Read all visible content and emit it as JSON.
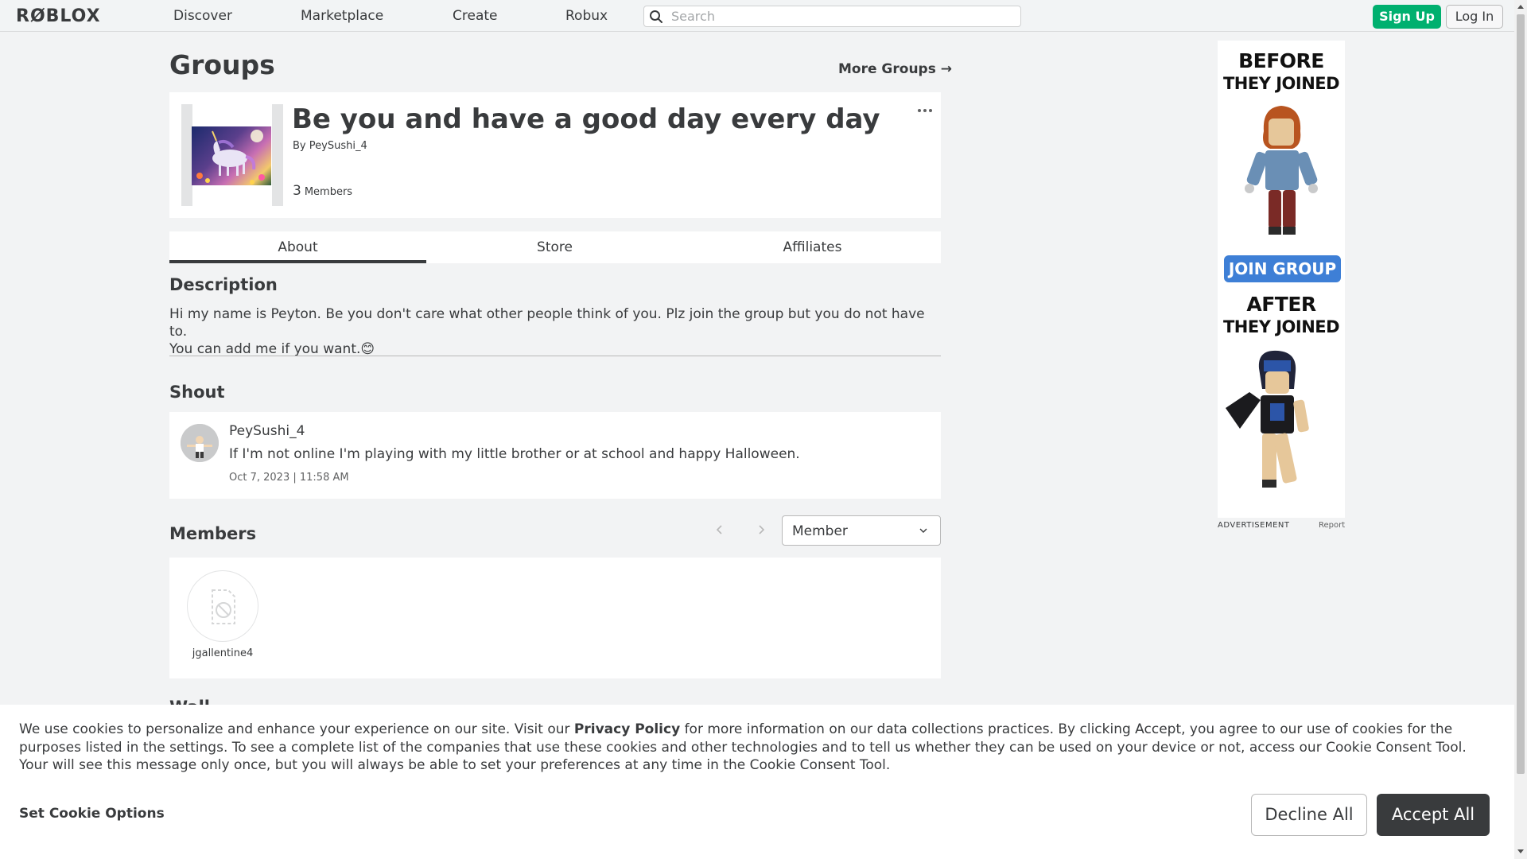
{
  "nav": {
    "logo": "RØBLOX",
    "links": [
      "Discover",
      "Marketplace",
      "Create",
      "Robux"
    ],
    "search_placeholder": "Search",
    "signup": "Sign Up",
    "login": "Log In"
  },
  "page": {
    "title": "Groups",
    "more_groups": "More Groups →"
  },
  "group": {
    "name": "Be you and have a good day every day",
    "by_prefix": "By",
    "owner": "PeySushi_4",
    "member_count": "3",
    "member_label": "Members"
  },
  "tabs": [
    "About",
    "Store",
    "Affiliates"
  ],
  "about": {
    "description_heading": "Description",
    "description_line1": "Hi my name is Peyton. Be you don't care what other people think of you. Plz join the group but you do not have to.",
    "description_line2": "You can add me if you want.😊"
  },
  "shout": {
    "heading": "Shout",
    "user": "PeySushi_4",
    "text": "If I'm not online I'm playing with my little brother or at school and happy Halloween.",
    "date": "Oct 7, 2023 | 11:58 AM"
  },
  "members": {
    "heading": "Members",
    "role_selected": "Member",
    "list": [
      {
        "name": "jgallentine4"
      }
    ]
  },
  "wall": {
    "heading": "Wall"
  },
  "ad": {
    "line1": "BEFORE",
    "line2": "THEY JOINED",
    "join": "JOIN GROUP",
    "line3": "AFTER",
    "line4": "THEY JOINED",
    "label": "ADVERTISEMENT",
    "report": "Report"
  },
  "cookie": {
    "text_before": "We use cookies to personalize and enhance your experience on our site. Visit our ",
    "privacy_link": "Privacy Policy",
    "text_after": " for more information on our data collections practices. By clicking Accept, you agree to our use of cookies for the purposes listed in the settings. To see a complete list of the companies that use these cookies and other technologies and to tell us whether they can be used on your device or not, access our Cookie Consent Tool. Your will see this message only once, but you will always be able to set your preferences at any time in the Cookie Consent Tool.",
    "options": "Set Cookie Options",
    "decline": "Decline All",
    "accept": "Accept All"
  }
}
